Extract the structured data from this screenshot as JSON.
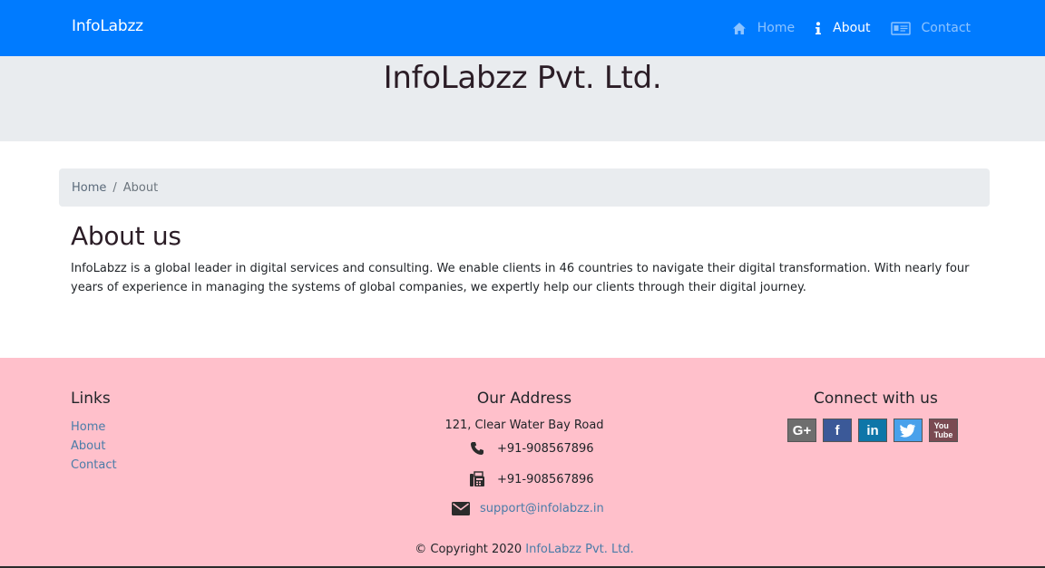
{
  "navbar": {
    "brand": "InfoLabzz",
    "items": [
      {
        "label": "Home",
        "icon": "home-icon",
        "active": false
      },
      {
        "label": "About",
        "icon": "info-icon",
        "active": true
      },
      {
        "label": "Contact",
        "icon": "contact-card-icon",
        "active": false
      }
    ]
  },
  "jumbotron": {
    "title": "InfoLabzz Pvt. Ltd."
  },
  "breadcrumb": {
    "home": "Home",
    "separator": "/",
    "current": "About"
  },
  "about": {
    "heading": "About us",
    "text": "InfoLabzz is a global leader in digital services and consulting. We enable clients in 46 countries to navigate their digital transformation. With nearly four years of experience in managing the systems of global companies, we expertly help our clients through their digital journey."
  },
  "footer": {
    "links_title": "Links",
    "links": [
      "Home",
      "About",
      "Contact"
    ],
    "address_title": "Our Address",
    "address_line": "121, Clear Water Bay Road",
    "phone": "+91-908567896",
    "fax": "+91-908567896",
    "email": "support@infolabzz.in",
    "connect_title": "Connect with us",
    "socials": [
      "google-plus-icon",
      "facebook-icon",
      "linkedin-icon",
      "twitter-icon",
      "youtube-icon"
    ],
    "copyright_prefix": "© Copyright 2020",
    "copyright_company": "InfoLabzz Pvt. Ltd."
  },
  "colors": {
    "navbar": "#007bff",
    "jumbotron": "#e9ecef",
    "footer": "#ffc0cb",
    "link": "#4a7ca8"
  }
}
